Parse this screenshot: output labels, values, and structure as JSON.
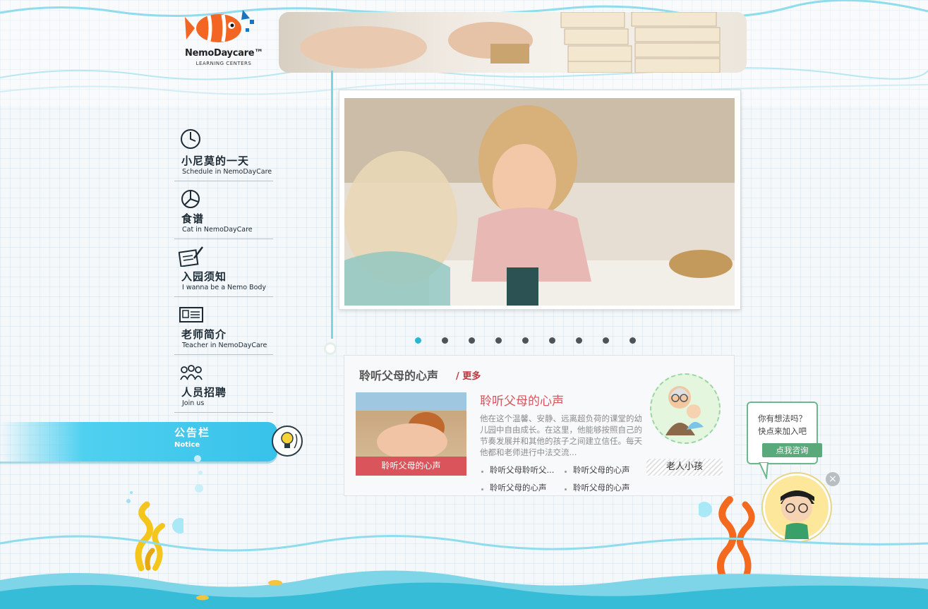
{
  "logo": {
    "brand": "NemoDaycare™",
    "subtitle": "LEARNING CENTERS"
  },
  "nav": [
    {
      "cn": "小尼莫的一天",
      "en": "Schedule in NemoDayCare",
      "icon": "clock-icon"
    },
    {
      "cn": "食谱",
      "en": "Cat in NemoDayCare",
      "icon": "pie-chart-icon"
    },
    {
      "cn": "入园须知",
      "en": "I wanna be a Nemo Body",
      "icon": "notepad-pen-icon"
    },
    {
      "cn": "老师简介",
      "en": "Teacher in NemoDayCare",
      "icon": "id-card-icon"
    },
    {
      "cn": "人员招聘",
      "en": "Join us",
      "icon": "people-icon"
    }
  ],
  "notice": {
    "cn": "公告栏",
    "en": "Notice",
    "icon": "lightbulb-icon"
  },
  "slideshow": {
    "total": 9,
    "active": 1
  },
  "parents": {
    "title": "聆听父母的心声",
    "more": "/ 更多",
    "headline": "聆听父母的心声",
    "thumb_caption": "聆听父母的心声",
    "description": "他在这个温馨、安静、远离超负荷的课堂的幼儿园中自由成长。在这里，他能够按照自己的节奏发展并和其他的孩子之间建立信任。每天他都和老师进行中法交流...",
    "links": [
      "聆听父母聆听父...",
      "聆听父母的心声",
      "聆听父母的心声",
      "聆听父母的心声"
    ],
    "tag": "老人小孩"
  },
  "consult": {
    "line1": "你有想法吗？",
    "line2": "快点来加入吧",
    "button": "点我咨询"
  },
  "colors": {
    "accent": "#27b7d3",
    "red": "#d9555b",
    "green": "#5aa97b",
    "notice": "#38c2ea"
  }
}
